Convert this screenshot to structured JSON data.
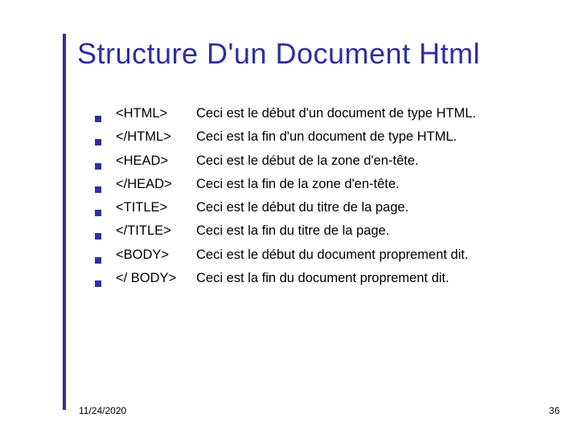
{
  "title": "Structure D'un Document Html",
  "rows": [
    {
      "tag": "<HTML>",
      "desc": "Ceci est le début d'un document de type HTML."
    },
    {
      "tag": "</HTML>",
      "desc": "Ceci est la fin d'un document de type HTML."
    },
    {
      "tag": "<HEAD>",
      "desc": "Ceci est le début de la zone d'en-tête."
    },
    {
      "tag": "</HEAD>",
      "desc": "Ceci est la fin de la zone d'en-tête."
    },
    {
      "tag": "<TITLE>",
      "desc": "Ceci est le début du titre de la page."
    },
    {
      "tag": "</TITLE>",
      "desc": "Ceci est la fin du titre de la page."
    },
    {
      "tag": "<BODY>",
      "desc": "Ceci est le début du document proprement dit."
    },
    {
      "tag": "</ BODY>",
      "desc": "Ceci est la fin du document proprement dit."
    }
  ],
  "footer": {
    "date": "11/24/2020",
    "page": "36"
  }
}
